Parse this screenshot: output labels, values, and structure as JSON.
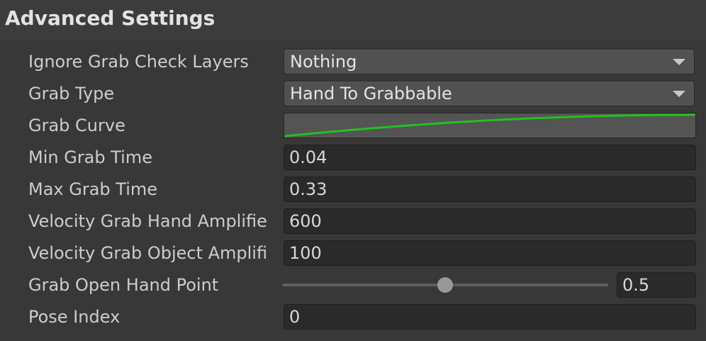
{
  "header": {
    "title": "Advanced Settings"
  },
  "fields": {
    "ignore_grab_check_layers": {
      "label": "Ignore Grab Check Layers",
      "value": "Nothing"
    },
    "grab_type": {
      "label": "Grab Type",
      "value": "Hand To Grabbable"
    },
    "grab_curve": {
      "label": "Grab Curve",
      "curve_color": "#22c020"
    },
    "min_grab_time": {
      "label": "Min Grab Time",
      "value": "0.04"
    },
    "max_grab_time": {
      "label": "Max Grab Time",
      "value": "0.33"
    },
    "velocity_grab_hand_amplifier": {
      "label": "Velocity Grab Hand Amplifie",
      "value": "600"
    },
    "velocity_grab_object_amplifier": {
      "label": "Velocity Grab Object Amplifi",
      "value": "100"
    },
    "grab_open_hand_point": {
      "label": "Grab Open Hand Point",
      "value": "0.5",
      "slider_fraction": 0.5
    },
    "pose_index": {
      "label": "Pose Index",
      "value": "0"
    }
  },
  "icons": {
    "dropdown_arrow": "chevron-down-icon"
  }
}
